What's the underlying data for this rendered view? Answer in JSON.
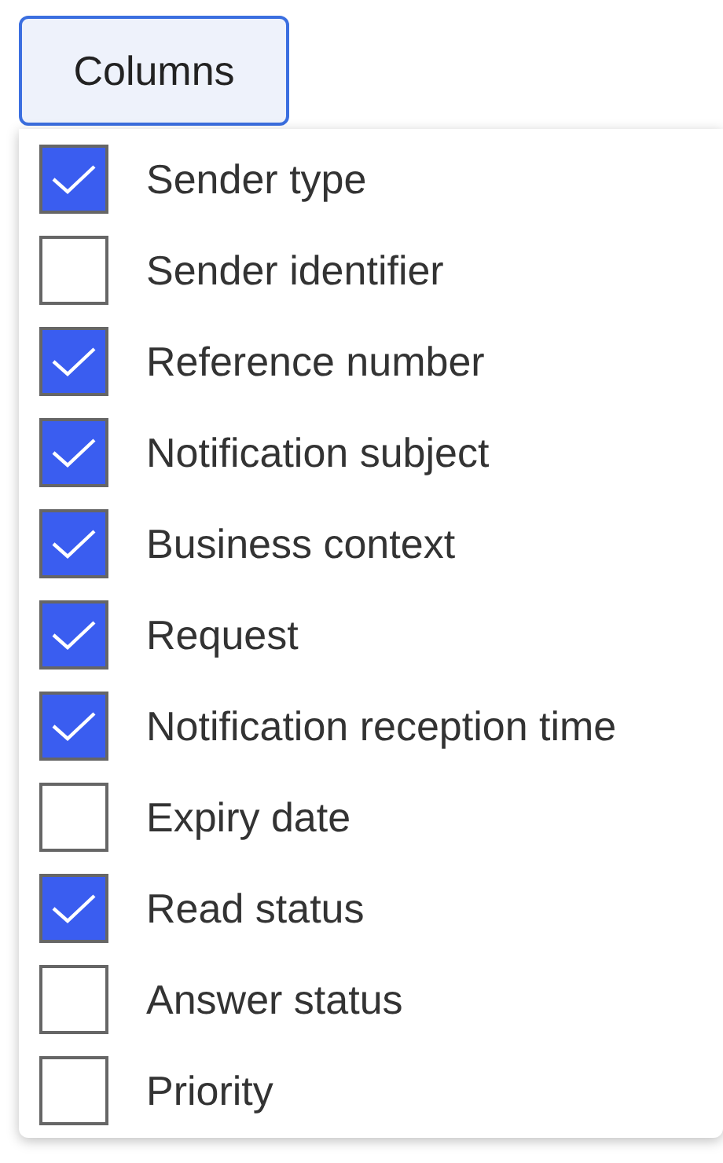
{
  "columns_button": {
    "label": "Columns"
  },
  "options": [
    {
      "label": "Sender type",
      "checked": true
    },
    {
      "label": "Sender identifier",
      "checked": false
    },
    {
      "label": "Reference number",
      "checked": true
    },
    {
      "label": "Notification subject",
      "checked": true
    },
    {
      "label": "Business context",
      "checked": true
    },
    {
      "label": "Request",
      "checked": true
    },
    {
      "label": "Notification reception time",
      "checked": true
    },
    {
      "label": "Expiry date",
      "checked": false
    },
    {
      "label": "Read status",
      "checked": true
    },
    {
      "label": "Answer status",
      "checked": false
    },
    {
      "label": "Priority",
      "checked": false
    }
  ]
}
